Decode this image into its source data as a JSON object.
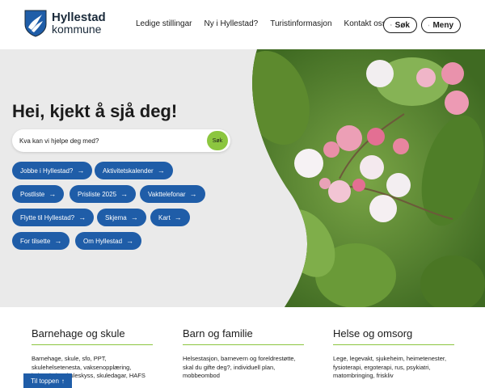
{
  "brand": {
    "name": "Hyllestad",
    "sub": "kommune"
  },
  "nav": [
    "Ledige stillingar",
    "Ny i Hyllestad?",
    "Turistinformasjon",
    "Kontakt oss"
  ],
  "header_buttons": {
    "search": "Søk",
    "menu": "Meny"
  },
  "hero": {
    "title": "Hei, kjekt å sjå deg!",
    "search_placeholder": "Kva kan vi hjelpe deg med?",
    "search_button": "Søk"
  },
  "quick_links": [
    "Jobbe i Hyllestad?",
    "Aktivitetskalender",
    "Postliste",
    "Prisliste 2025",
    "Vakttelefonar",
    "Flytte til Hyllestad?",
    "Skjema",
    "Kart",
    "For tilsette",
    "Om Hyllestad"
  ],
  "sections": [
    {
      "title": "Barnehage og skule",
      "desc": "Barnehage, skule, sfo, PPT, skulehelsetenesta, vaksenopplæring, kulturskule, skuleskyss, skuledagar, HAFS oppvekst"
    },
    {
      "title": "Barn og familie",
      "desc": "Helsestasjon, barnevern og foreldrestøtte, skal du gifte deg?, individuell plan, mobbeombod"
    },
    {
      "title": "Helse og omsorg",
      "desc": "Lege, legevakt, sjukeheim, heimetenester, fysioterapi, ergoterapi, rus, psykiatri, matombringing, friskliv"
    }
  ],
  "to_top": "Til toppen",
  "colors": {
    "primary": "#1f5da8",
    "accent": "#8cc63f",
    "hero_bg": "#eaeaea"
  }
}
